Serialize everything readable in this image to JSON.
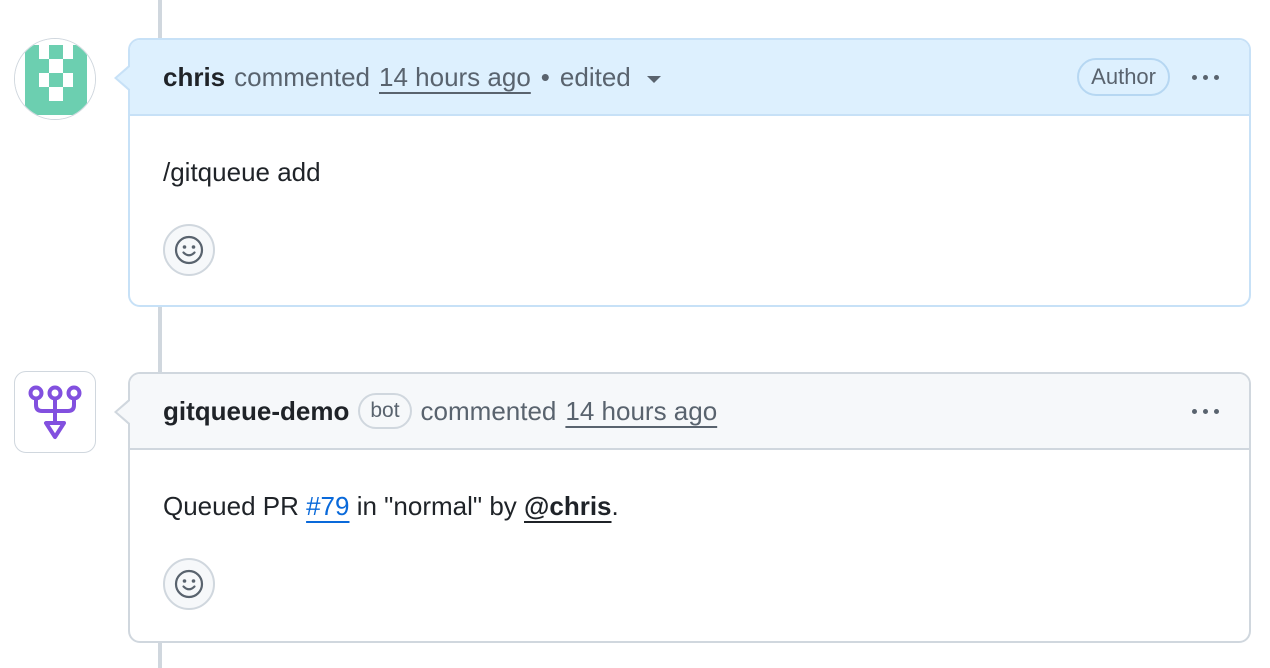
{
  "comments": [
    {
      "username": "chris",
      "action": "commented",
      "timestamp": "14 hours ago",
      "separator": "•",
      "edited_label": "edited",
      "badge": "Author",
      "body": "/gitqueue add",
      "avatar_icon": "identicon-avatar",
      "accent": "#ddf0fe"
    },
    {
      "username": "gitqueue-demo",
      "badge": "bot",
      "action": "commented",
      "timestamp": "14 hours ago",
      "body_prefix": "Queued PR ",
      "pr_link": "#79",
      "body_middle": " in \"normal\" by ",
      "mention": "@chris",
      "body_suffix": ".",
      "avatar_icon": "merge-queue-icon",
      "accent": "#8250df"
    }
  ],
  "colors": {
    "link": "#0969da",
    "author_header_bg": "#ddf0fe",
    "bot_header_bg": "#f6f8fa",
    "bot_logo": "#8250df",
    "identicon": "#6ccfb0"
  }
}
